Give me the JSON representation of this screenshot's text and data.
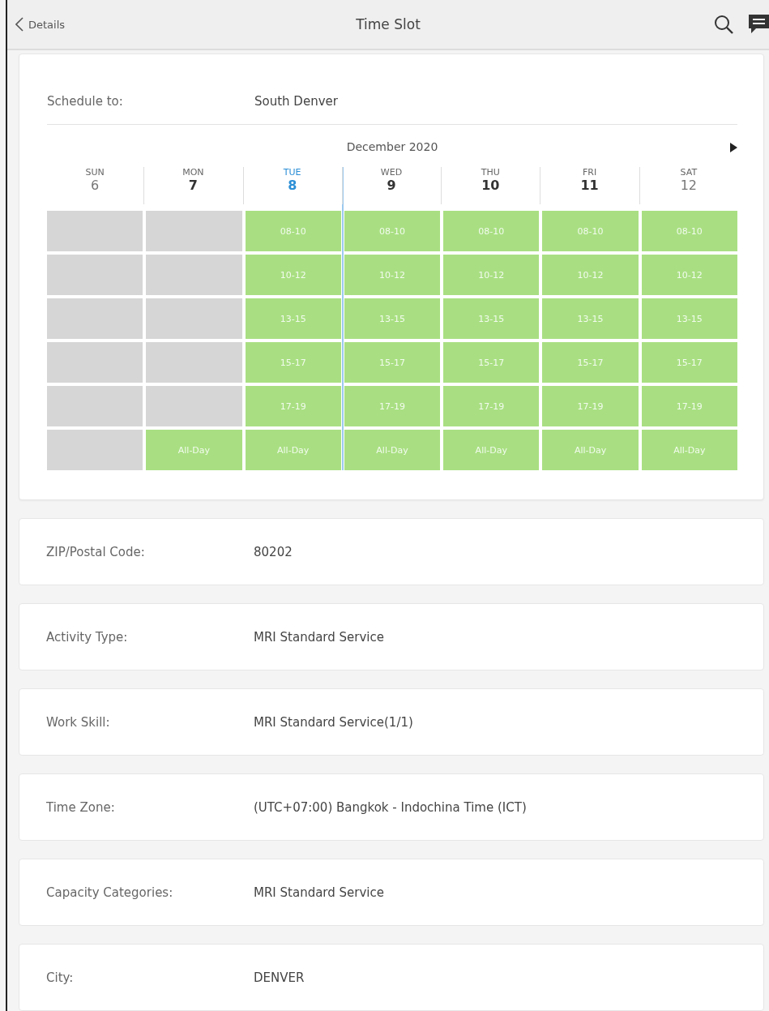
{
  "header": {
    "back": "Details",
    "title": "Time Slot"
  },
  "schedule": {
    "label": "Schedule to:",
    "value": "South Denver"
  },
  "calendar": {
    "month": "December 2020",
    "days": [
      {
        "name": "SUN",
        "date": "6",
        "weekend": true,
        "today": false,
        "slots": [
          {
            "available": false
          },
          {
            "available": false
          },
          {
            "available": false
          },
          {
            "available": false
          },
          {
            "available": false
          },
          {
            "available": false
          }
        ]
      },
      {
        "name": "MON",
        "date": "7",
        "weekend": false,
        "today": false,
        "slots": [
          {
            "available": false
          },
          {
            "available": false
          },
          {
            "available": false
          },
          {
            "available": false
          },
          {
            "available": false
          },
          {
            "available": true,
            "label": "All-Day"
          }
        ]
      },
      {
        "name": "TUE",
        "date": "8",
        "weekend": false,
        "today": true,
        "slots": [
          {
            "available": true,
            "label": "08-10"
          },
          {
            "available": true,
            "label": "10-12"
          },
          {
            "available": true,
            "label": "13-15"
          },
          {
            "available": true,
            "label": "15-17"
          },
          {
            "available": true,
            "label": "17-19"
          },
          {
            "available": true,
            "label": "All-Day"
          }
        ]
      },
      {
        "name": "WED",
        "date": "9",
        "weekend": false,
        "today": false,
        "slots": [
          {
            "available": true,
            "label": "08-10"
          },
          {
            "available": true,
            "label": "10-12"
          },
          {
            "available": true,
            "label": "13-15"
          },
          {
            "available": true,
            "label": "15-17"
          },
          {
            "available": true,
            "label": "17-19"
          },
          {
            "available": true,
            "label": "All-Day"
          }
        ]
      },
      {
        "name": "THU",
        "date": "10",
        "weekend": false,
        "today": false,
        "slots": [
          {
            "available": true,
            "label": "08-10"
          },
          {
            "available": true,
            "label": "10-12"
          },
          {
            "available": true,
            "label": "13-15"
          },
          {
            "available": true,
            "label": "15-17"
          },
          {
            "available": true,
            "label": "17-19"
          },
          {
            "available": true,
            "label": "All-Day"
          }
        ]
      },
      {
        "name": "FRI",
        "date": "11",
        "weekend": false,
        "today": false,
        "slots": [
          {
            "available": true,
            "label": "08-10"
          },
          {
            "available": true,
            "label": "10-12"
          },
          {
            "available": true,
            "label": "13-15"
          },
          {
            "available": true,
            "label": "15-17"
          },
          {
            "available": true,
            "label": "17-19"
          },
          {
            "available": true,
            "label": "All-Day"
          }
        ]
      },
      {
        "name": "SAT",
        "date": "12",
        "weekend": true,
        "today": false,
        "slots": [
          {
            "available": true,
            "label": "08-10"
          },
          {
            "available": true,
            "label": "10-12"
          },
          {
            "available": true,
            "label": "13-15"
          },
          {
            "available": true,
            "label": "15-17"
          },
          {
            "available": true,
            "label": "17-19"
          },
          {
            "available": true,
            "label": "All-Day"
          }
        ]
      }
    ]
  },
  "fields": [
    {
      "label": "ZIP/Postal Code:",
      "value": "80202"
    },
    {
      "label": "Activity Type:",
      "value": "MRI Standard Service"
    },
    {
      "label": "Work Skill:",
      "value": "MRI Standard Service(1/1)"
    },
    {
      "label": "Time Zone:",
      "value": "(UTC+07:00) Bangkok - Indochina Time (ICT)"
    },
    {
      "label": "Capacity Categories:",
      "value": "MRI Standard Service"
    },
    {
      "label": "City:",
      "value": "DENVER"
    }
  ]
}
